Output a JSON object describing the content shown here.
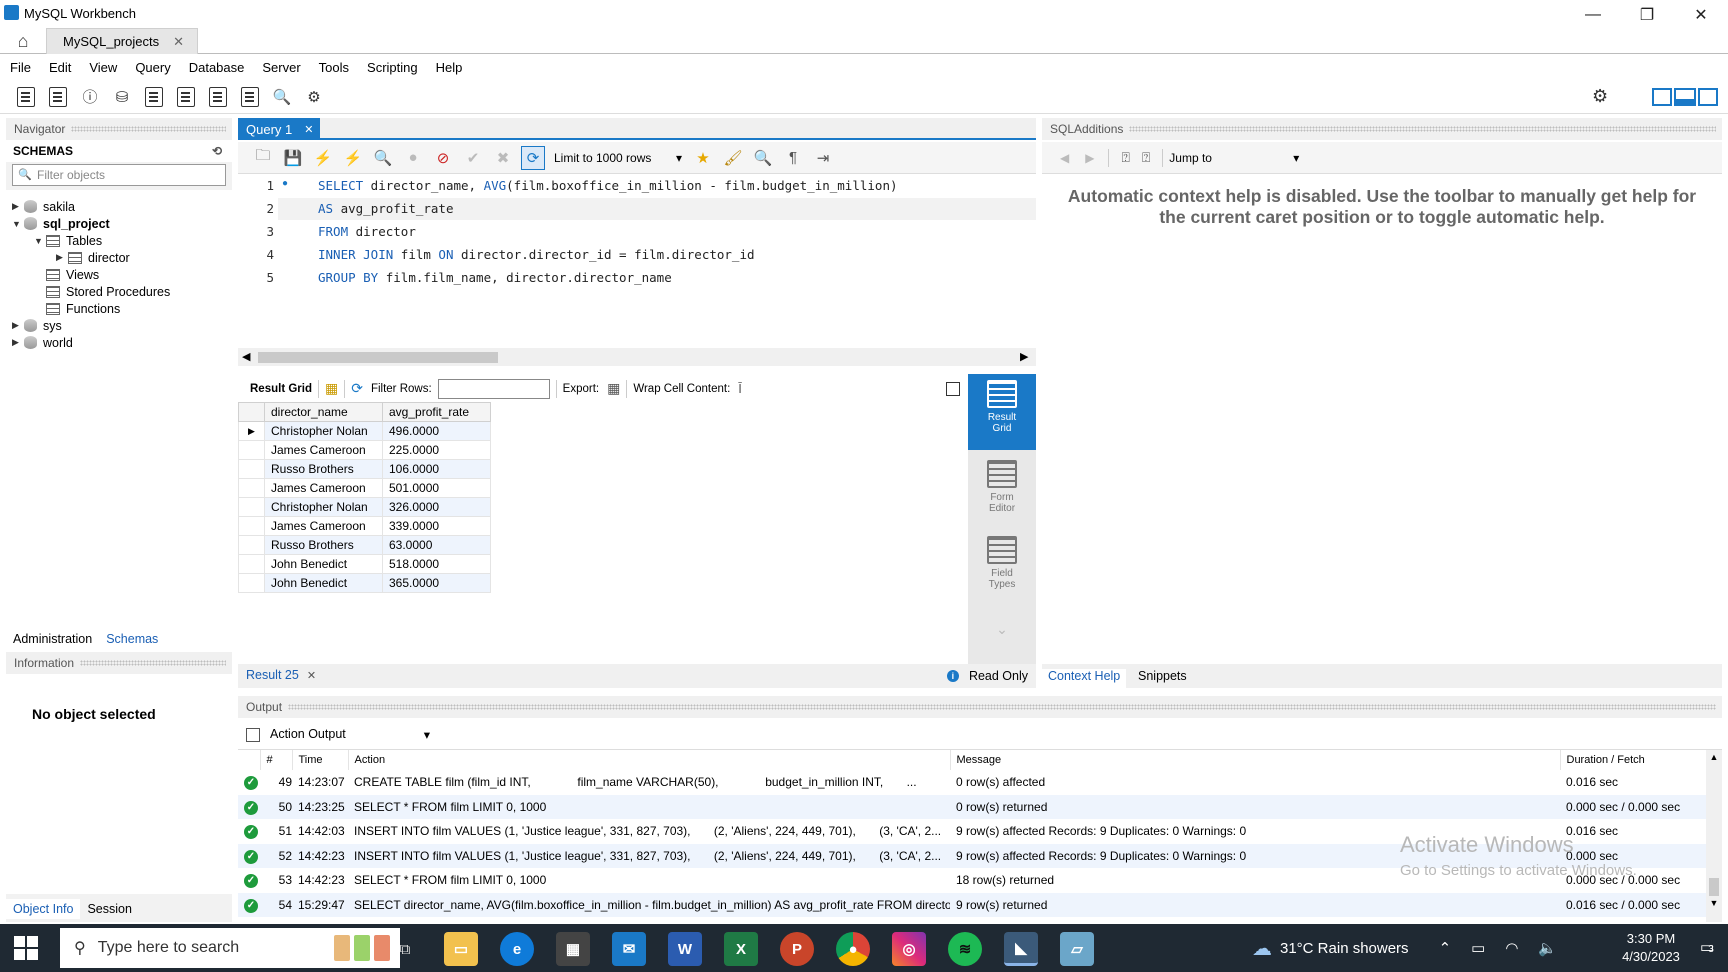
{
  "window": {
    "title": "MySQL Workbench",
    "min": "—",
    "max": "❐",
    "close": "✕"
  },
  "tab": {
    "label": "MySQL_projects",
    "close": "✕"
  },
  "menu": [
    "File",
    "Edit",
    "View",
    "Query",
    "Database",
    "Server",
    "Tools",
    "Scripting",
    "Help"
  ],
  "navigator": {
    "header": "Navigator",
    "schemas_label": "SCHEMAS",
    "filter_placeholder": "Filter objects",
    "tree": {
      "sakila": "sakila",
      "sql_project": "sql_project",
      "tables": "Tables",
      "director": "director",
      "views": "Views",
      "procedures": "Stored Procedures",
      "functions": "Functions",
      "sys": "sys",
      "world": "world"
    },
    "tabs": {
      "administration": "Administration",
      "schemas": "Schemas"
    },
    "information_header": "Information",
    "no_object": "No object selected",
    "bottom_tabs": {
      "object_info": "Object Info",
      "session": "Session"
    }
  },
  "query": {
    "tab_label": "Query 1",
    "limit": "Limit to 1000 rows",
    "lines": [
      "1",
      "2",
      "3",
      "4",
      "5"
    ]
  },
  "result": {
    "grid_label": "Result Grid",
    "filter_label": "Filter Rows:",
    "export_label": "Export:",
    "wrap_label": "Wrap Cell Content:",
    "columns": [
      "director_name",
      "avg_profit_rate"
    ],
    "rows": [
      [
        "Christopher Nolan",
        "496.0000"
      ],
      [
        "James Cameroon",
        "225.0000"
      ],
      [
        "Russo Brothers",
        "106.0000"
      ],
      [
        "James Cameroon",
        "501.0000"
      ],
      [
        "Christopher Nolan",
        "326.0000"
      ],
      [
        "James Cameroon",
        "339.0000"
      ],
      [
        "Russo Brothers",
        "63.0000"
      ],
      [
        "John Benedict",
        "518.0000"
      ],
      [
        "John Benedict",
        "365.0000"
      ]
    ],
    "side": {
      "result_grid": "Result Grid",
      "form_editor": "Form Editor",
      "field_types": "Field Types"
    },
    "tab": "Result 25",
    "read_only": "Read Only"
  },
  "sql_additions": {
    "header": "SQLAdditions",
    "jump_to": "Jump to",
    "message": "Automatic context help is disabled. Use the toolbar to manually get help for the current caret position or to toggle automatic help.",
    "tabs": {
      "context_help": "Context Help",
      "snippets": "Snippets"
    }
  },
  "output": {
    "header": "Output",
    "selector": "Action Output",
    "columns": [
      "#",
      "Time",
      "Action",
      "Message",
      "Duration / Fetch"
    ],
    "rows": [
      {
        "n": "49",
        "time": "14:23:07",
        "action": "CREATE TABLE film (film_id INT,              film_name VARCHAR(50),              budget_in_million INT,       ...",
        "message": "0 row(s) affected",
        "duration": "0.016 sec"
      },
      {
        "n": "50",
        "time": "14:23:25",
        "action": "SELECT * FROM film LIMIT 0, 1000",
        "message": "0 row(s) returned",
        "duration": "0.000 sec / 0.000 sec"
      },
      {
        "n": "51",
        "time": "14:42:03",
        "action": "INSERT INTO film VALUES (1, 'Justice league', 331, 827, 703),       (2, 'Aliens', 224, 449, 701),       (3, 'CA', 2...",
        "message": "9 row(s) affected Records: 9  Duplicates: 0  Warnings: 0",
        "duration": "0.016 sec"
      },
      {
        "n": "52",
        "time": "14:42:23",
        "action": "INSERT INTO film VALUES (1, 'Justice league', 331, 827, 703),       (2, 'Aliens', 224, 449, 701),       (3, 'CA', 2...",
        "message": "9 row(s) affected Records: 9  Duplicates: 0  Warnings: 0",
        "duration": "0.000 sec"
      },
      {
        "n": "53",
        "time": "14:42:23",
        "action": "SELECT * FROM film LIMIT 0, 1000",
        "message": "18 row(s) returned",
        "duration": "0.000 sec / 0.000 sec"
      },
      {
        "n": "54",
        "time": "15:29:47",
        "action": "SELECT director_name, AVG(film.boxoffice_in_million - film.budget_in_million) AS avg_profit_rate FROM directo...",
        "message": "9 row(s) returned",
        "duration": "0.016 sec / 0.000 sec"
      }
    ]
  },
  "watermark": {
    "line1": "Activate Windows",
    "line2": "Go to Settings to activate Windows."
  },
  "taskbar": {
    "search_placeholder": "Type here to search",
    "weather": "31°C  Rain showers",
    "time": "3:30 PM",
    "date": "4/30/2023",
    "notif": "3"
  },
  "colors": {
    "accent": "#1a79c7",
    "ok": "#1e9b3c",
    "keyword": "#1a5fb4"
  }
}
